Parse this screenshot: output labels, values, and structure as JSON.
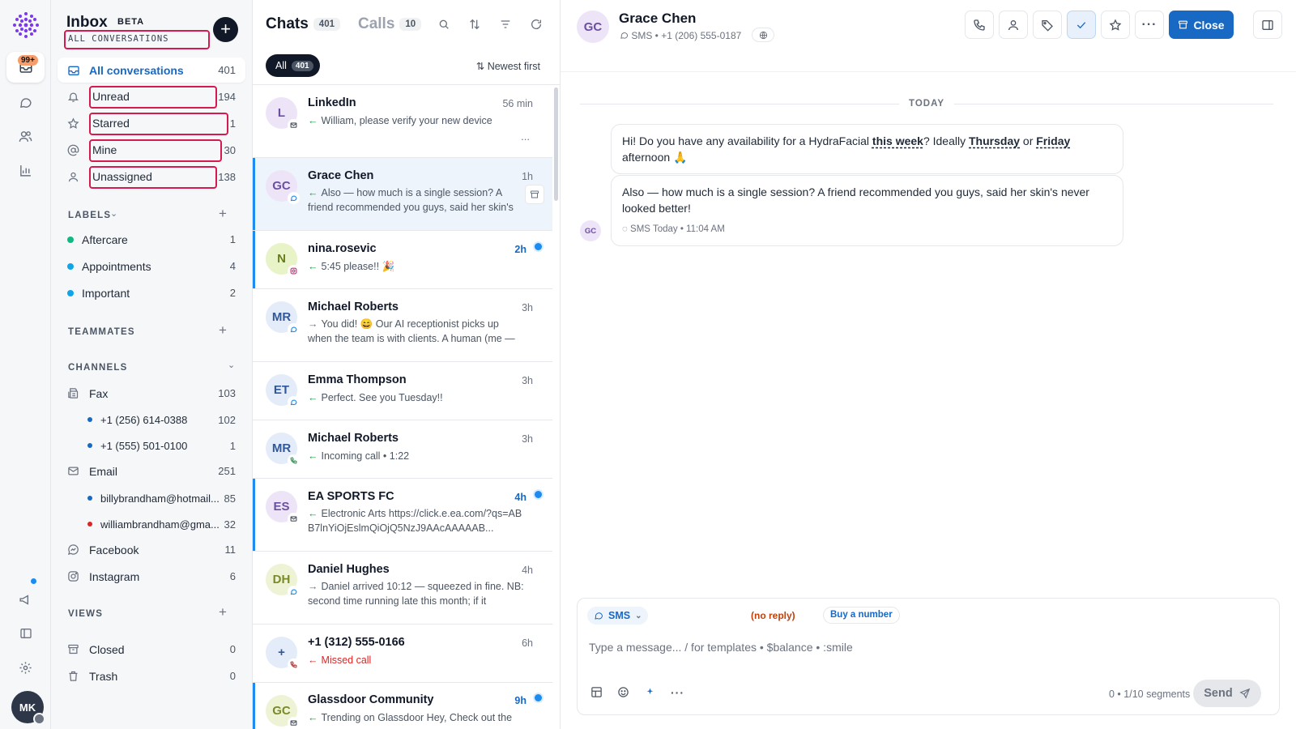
{
  "rail": {
    "badge": "99+",
    "user_initials": "MK"
  },
  "sidebar": {
    "title": "Inbox",
    "beta": "BETA",
    "subtitle": "ALL CONVERSATIONS",
    "new_button": "+",
    "items": [
      {
        "label": "All conversations",
        "count": "401",
        "icon": "inbox-icon"
      },
      {
        "label": "Unread",
        "count": "194",
        "icon": "bell-icon"
      },
      {
        "label": "Starred",
        "count": "1",
        "icon": "star-icon"
      },
      {
        "label": "Mine",
        "count": "30",
        "icon": "at-icon"
      },
      {
        "label": "Unassigned",
        "count": "138",
        "icon": "user-icon"
      }
    ],
    "labels_heading": "LABELS",
    "labels": [
      {
        "label": "Aftercare",
        "count": "1",
        "color": "#10b981"
      },
      {
        "label": "Appointments",
        "count": "4",
        "color": "#0ea5e9"
      },
      {
        "label": "Important",
        "count": "2",
        "color": "#0ea5e9"
      }
    ],
    "teammates_heading": "TEAMMATES",
    "channels_heading": "CHANNELS",
    "channels": {
      "fax": {
        "label": "Fax",
        "count": "103"
      },
      "fax_numbers": [
        {
          "label": "+1 (256) 614-0388",
          "count": "102",
          "color": "#1769c4"
        },
        {
          "label": "+1 (555) 501-0100",
          "count": "1",
          "color": "#1769c4"
        }
      ],
      "email": {
        "label": "Email",
        "count": "251"
      },
      "email_accounts": [
        {
          "label": "billybrandham@hotmail...",
          "count": "85",
          "color": "#1769c4"
        },
        {
          "label": "williambrandham@gma...",
          "count": "32",
          "color": "#dc2626"
        }
      ],
      "facebook": {
        "label": "Facebook",
        "count": "11"
      },
      "instagram": {
        "label": "Instagram",
        "count": "6"
      }
    },
    "views_heading": "VIEWS",
    "views": [
      {
        "label": "Closed",
        "count": "0"
      },
      {
        "label": "Trash",
        "count": "0"
      }
    ]
  },
  "list": {
    "tab_chats": "Chats",
    "tab_chats_count": "401",
    "tab_calls": "Calls",
    "tab_calls_count": "10",
    "filter_chip": "All",
    "filter_chip_count": "401",
    "sort_label": "Newest first",
    "conversations": [
      {
        "initials": "L",
        "name": "LinkedIn",
        "time": "56 min",
        "preview": "William, please verify your new device",
        "extra": "...",
        "dir": "in",
        "channel": "email"
      },
      {
        "initials": "GC",
        "name": "Grace Chen",
        "time": "1h",
        "preview": "Also — how much is a single session? A friend recommended you guys, said her skin's never...",
        "dir": "in",
        "channel": "sms"
      },
      {
        "initials": "N",
        "name": "nina.rosevic",
        "time": "2h",
        "preview": "5:45 please!! 🎉",
        "dir": "in",
        "channel": "instagram"
      },
      {
        "initials": "MR",
        "name": "Michael Roberts",
        "time": "3h",
        "preview": "You did! 😄 Our AI receptionist picks up when the team is with clients. A human (me — Sarah!)...",
        "dir": "out",
        "channel": "sms"
      },
      {
        "initials": "ET",
        "name": "Emma Thompson",
        "time": "3h",
        "preview": "Perfect. See you Tuesday!!",
        "dir": "in",
        "channel": "sms"
      },
      {
        "initials": "MR",
        "name": "Michael Roberts",
        "time": "3h",
        "preview": "Incoming call • 1:22",
        "dir": "in",
        "channel": "call"
      },
      {
        "initials": "ES",
        "name": "EA SPORTS FC",
        "time": "4h",
        "preview": "Electronic Arts https://click.e.ea.com/?qs=ABB7lnYiOjEslmQiOjQ5NzJ9AAcAAAAAB...",
        "dir": "in",
        "channel": "email"
      },
      {
        "initials": "DH",
        "name": "Daniel Hughes",
        "time": "4h",
        "preview": "Daniel arrived 10:12 — squeezed in fine. NB: second time running late this month; if it happen...",
        "dir": "out",
        "channel": "sms"
      },
      {
        "initials": "+",
        "name": "+1 (312) 555-0166",
        "time": "6h",
        "preview": "Missed call",
        "dir": "missed",
        "channel": "call-missed"
      },
      {
        "initials": "GC",
        "name": "Glassdoor Community",
        "time": "9h",
        "preview": "Trending on Glassdoor Hey, Check out the",
        "dir": "in",
        "channel": "email"
      }
    ]
  },
  "pane": {
    "contact_initials": "GC",
    "contact_name": "Grace Chen",
    "contact_sub": "SMS • +1 (206) 555-0187",
    "close_label": "Close",
    "day_label": "TODAY",
    "message1": {
      "p1": "Hi! Do you have any availability for a HydraFacial ",
      "this_week": "this week",
      "p2": "? Ideally ",
      "thursday": "Thursday",
      "p3": " or ",
      "friday": "Friday",
      "p4": "afternoon 🙏"
    },
    "message2": {
      "text": "Also — how much is a single session? A friend recommended you guys, said her skin's never looked better!",
      "meta": "SMS  Today • 11:04 AM"
    },
    "composer": {
      "channel": "SMS",
      "no_reply": "(no reply)",
      "buy_number": "Buy a number",
      "placeholder": "Type a message...  /  for templates  •  $balance  •  :smile",
      "segments": "0 • 1/10 segments",
      "send": "Send"
    }
  }
}
